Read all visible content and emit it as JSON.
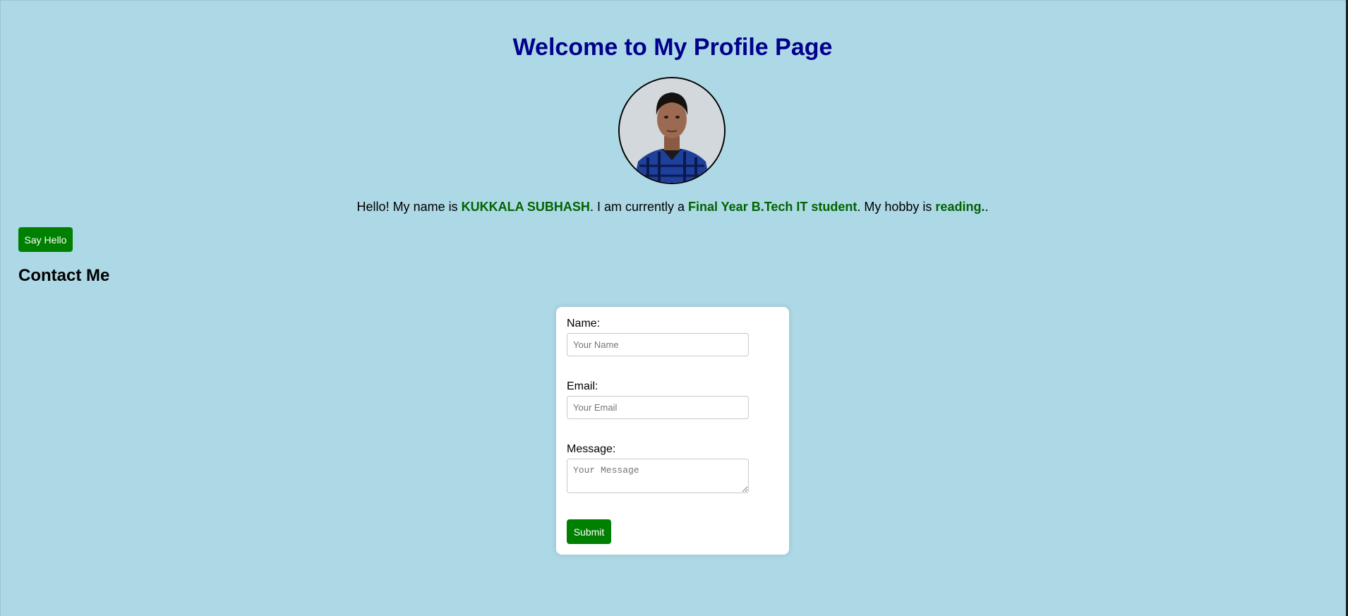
{
  "header": {
    "title": "Welcome to My Profile Page"
  },
  "profile": {
    "avatar_alt": "Profile photo",
    "intro_prefix": "Hello! My name is ",
    "name": "KUKKALA SUBHASH",
    "intro_mid1": ". I am currently a ",
    "study": "Final Year B.Tech IT student",
    "intro_mid2": ". My hobby is ",
    "hobby": "reading.",
    "intro_suffix": "."
  },
  "actions": {
    "say_hello_label": "Say Hello"
  },
  "contact": {
    "heading": "Contact Me",
    "name_label": "Name:",
    "name_placeholder": "Your Name",
    "email_label": "Email:",
    "email_placeholder": "Your Email",
    "message_label": "Message:",
    "message_placeholder": "Your Message",
    "submit_label": "Submit"
  },
  "colors": {
    "background": "#add8e6",
    "title": "#00008b",
    "highlight": "#006400",
    "button": "#008000"
  }
}
